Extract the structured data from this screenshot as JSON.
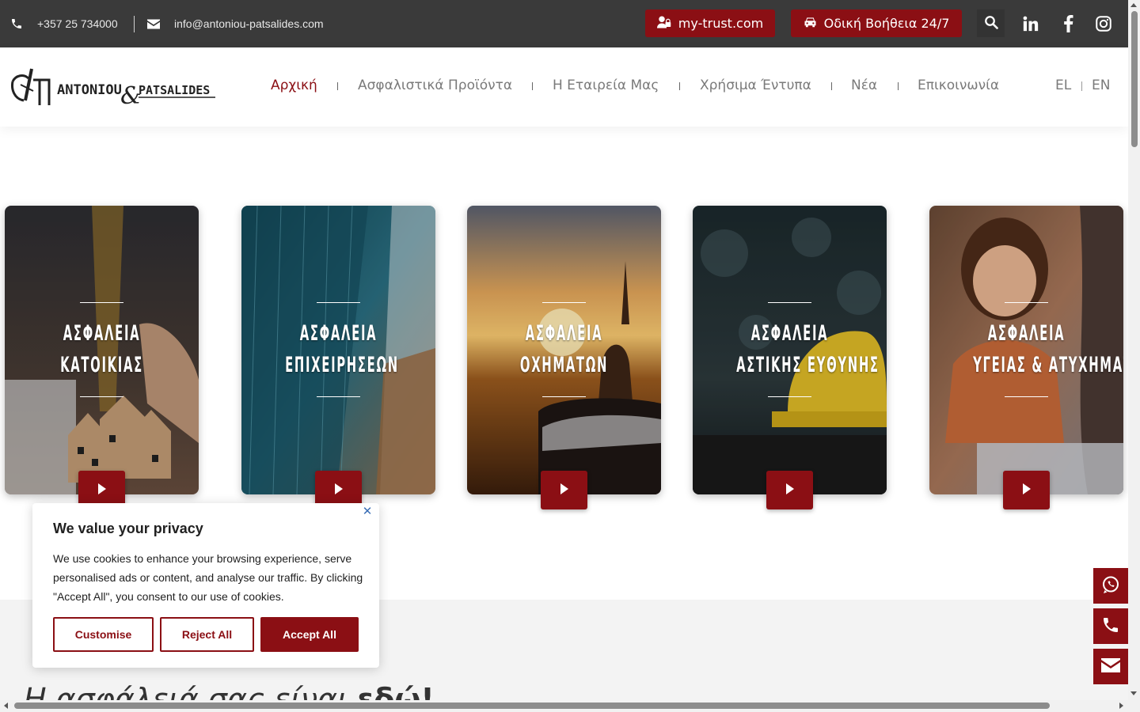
{
  "topbar": {
    "phone": "+357 25 734000",
    "email": "info@antoniou-patsalides.com",
    "trust_label": "my-trust.com",
    "road_label": "Οδική Βοήθεια 24/7",
    "socials": [
      "linkedin-icon",
      "facebook-icon",
      "instagram-icon"
    ]
  },
  "header": {
    "logo_text_left": "ANTONIOU",
    "logo_text_right": "PATSALIDES",
    "nav": [
      {
        "label": "Αρχική",
        "active": true
      },
      {
        "label": "Ασφαλιστικά Προϊόντα",
        "active": false
      },
      {
        "label": "Η Εταιρεία Μας",
        "active": false
      },
      {
        "label": "Χρήσιμα Έντυπα",
        "active": false
      },
      {
        "label": "Νέα",
        "active": false
      },
      {
        "label": "Επικοινωνία",
        "active": false
      }
    ],
    "languages": [
      "EL",
      "EN"
    ]
  },
  "cards": [
    {
      "line1": "ΑΣΦΑΛΕΙΑ",
      "line2": "ΚΑΤΟΙΚΙΑΣ"
    },
    {
      "line1": "ΑΣΦΑΛΕΙΑ",
      "line2": "ΕΠΙΧΕΙΡΗΣΕΩΝ"
    },
    {
      "line1": "ΑΣΦΑΛΕΙΑ",
      "line2": "ΟΧΗΜΑΤΩΝ"
    },
    {
      "line1": "ΑΣΦΑΛΕΙΑ",
      "line2": "ΑΣΤΙΚΗΣ ΕΥΘΥΝΗΣ"
    },
    {
      "line1": "ΑΣΦΑΛΕΙΑ",
      "line2": "ΥΓΕΙΑΣ & ΑΤΥΧΗΜΑΤΩΝ"
    }
  ],
  "cookie": {
    "title": "We value your privacy",
    "body": "We use cookies to enhance your browsing experience, serve personalised ads or content, and analyse our traffic. By clicking \"Accept All\", you consent to our use of cookies.",
    "customise": "Customise",
    "reject": "Reject All",
    "accept": "Accept All"
  },
  "section": {
    "heading_light": "Η ασφάλειά σας είναι",
    "heading_bold": "εδώ!"
  },
  "floating": [
    "whatsapp-icon",
    "phone-icon",
    "envelope-icon"
  ],
  "colors": {
    "brand": "#8b0f14",
    "topbar": "#3a3a3a"
  }
}
